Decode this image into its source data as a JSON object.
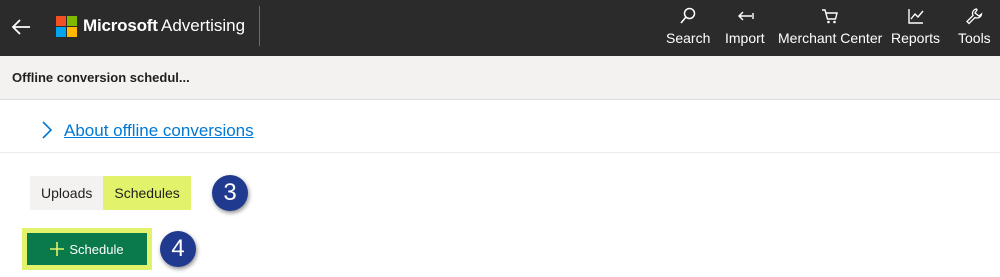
{
  "topbar": {
    "brand": "Microsoft",
    "product": "Advertising",
    "logo_colors": [
      "#f25022",
      "#7fba00",
      "#00a4ef",
      "#ffb900"
    ],
    "nav": [
      {
        "label": "Search",
        "icon": "search-icon"
      },
      {
        "label": "Import",
        "icon": "import-icon"
      },
      {
        "label": "Merchant Center",
        "icon": "cart-icon"
      },
      {
        "label": "Reports",
        "icon": "chart-icon"
      },
      {
        "label": "Tools",
        "icon": "wrench-icon"
      }
    ]
  },
  "breadcrumb": {
    "title": "Offline conversion schedul..."
  },
  "about": {
    "link_text": "About offline conversions"
  },
  "tabs": [
    {
      "label": "Uploads",
      "selected": false
    },
    {
      "label": "Schedules",
      "selected": true
    }
  ],
  "callouts": {
    "tabs_step": "3",
    "button_step": "4"
  },
  "actions": {
    "schedule_label": "Schedule"
  },
  "colors": {
    "topbar_bg": "#2b2b2b",
    "highlight": "#e2f26b",
    "primary_button": "#0b7a4b",
    "link": "#0078d4",
    "callout": "#1f3a8f"
  }
}
